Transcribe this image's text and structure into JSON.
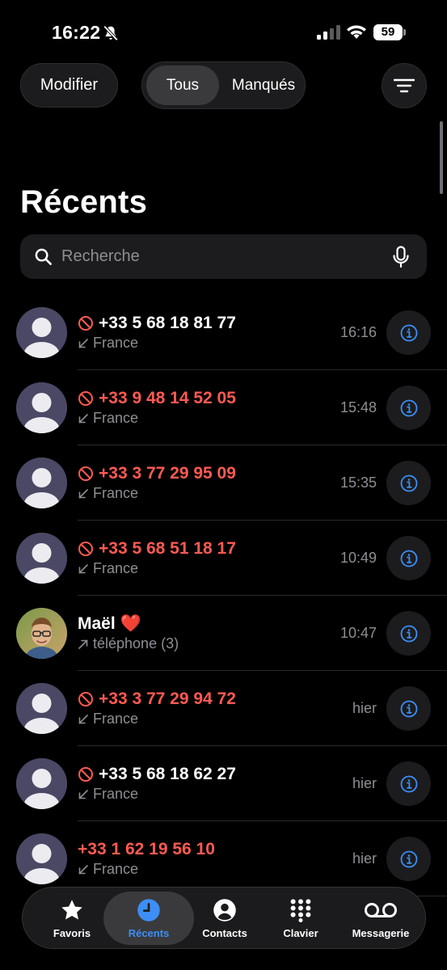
{
  "status_bar": {
    "time": "16:22",
    "battery_level": "59",
    "icons": [
      "bell-slash-icon",
      "signal-icon",
      "wifi-icon",
      "battery-icon"
    ]
  },
  "header": {
    "edit_label": "Modifier",
    "segments": [
      "Tous",
      "Manqués"
    ],
    "selected_segment": "Tous",
    "filter_icon": "filter-lines-icon"
  },
  "page_title": "Récents",
  "search": {
    "placeholder": "Recherche"
  },
  "colors": {
    "missed": "#ff5a52",
    "accent": "#3d8ef5",
    "secondary_text": "#8e8e93",
    "background": "#000000"
  },
  "calls": [
    {
      "name": "+33 5 68 18 81 77",
      "sub": "France",
      "time": "16:16",
      "missed": false,
      "blocked": true,
      "direction": "incoming"
    },
    {
      "name": "+33 9 48 14 52 05",
      "sub": "France",
      "time": "15:48",
      "missed": true,
      "blocked": true,
      "direction": "incoming"
    },
    {
      "name": "+33 3 77 29 95 09",
      "sub": "France",
      "time": "15:35",
      "missed": true,
      "blocked": true,
      "direction": "incoming"
    },
    {
      "name": "+33 5 68 51 18 17",
      "sub": "France",
      "time": "10:49",
      "missed": true,
      "blocked": true,
      "direction": "incoming"
    },
    {
      "name": "Maël ❤️",
      "sub": "téléphone (3)",
      "time": "10:47",
      "missed": false,
      "blocked": false,
      "direction": "outgoing",
      "photo": true
    },
    {
      "name": "+33 3 77 29 94 72",
      "sub": "France",
      "time": "hier",
      "missed": true,
      "blocked": true,
      "direction": "incoming"
    },
    {
      "name": "+33 5 68 18 62 27",
      "sub": "France",
      "time": "hier",
      "missed": false,
      "blocked": true,
      "direction": "incoming"
    },
    {
      "name": "+33 1 62 19 56 10",
      "sub": "France",
      "time": "hier",
      "missed": true,
      "blocked": false,
      "direction": "incoming"
    }
  ],
  "tabbar": {
    "items": [
      {
        "label": "Favoris",
        "icon": "star-icon",
        "active": false
      },
      {
        "label": "Récents",
        "icon": "clock-icon",
        "active": true
      },
      {
        "label": "Contacts",
        "icon": "person-circle-icon",
        "active": false
      },
      {
        "label": "Clavier",
        "icon": "keypad-icon",
        "active": false
      },
      {
        "label": "Messagerie",
        "icon": "voicemail-icon",
        "active": false
      }
    ]
  }
}
